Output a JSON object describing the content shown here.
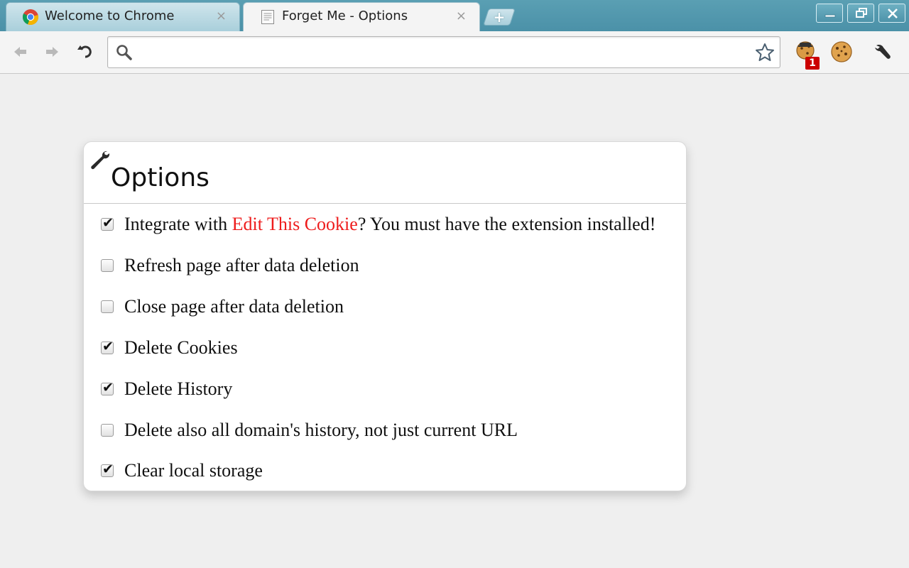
{
  "browser": {
    "tabs": [
      {
        "title": "Welcome to Chrome",
        "close": "×",
        "favicon": "chrome-logo-icon",
        "active": false
      },
      {
        "title": "Forget Me - Options",
        "close": "×",
        "favicon": "page-icon",
        "active": true
      }
    ],
    "new_tab_label": "+",
    "window_controls": [
      "minimize-icon",
      "restore-icon",
      "close-icon"
    ]
  },
  "toolbar": {
    "back": "back-arrow-icon",
    "forward": "forward-arrow-icon",
    "reload": "reload-icon",
    "omnibox": {
      "value": "",
      "placeholder": ""
    },
    "extensions": [
      {
        "name": "edit-this-cookie-agent-icon",
        "badge": "1"
      },
      {
        "name": "cookie-icon"
      }
    ],
    "menu": "wrench-menu-icon"
  },
  "options": {
    "title": "Options",
    "items": [
      {
        "checked": true,
        "before": "Integrate with ",
        "link": "Edit This Cookie",
        "after": "? You must have the extension installed!"
      },
      {
        "checked": false,
        "label": "Refresh page after data deletion"
      },
      {
        "checked": false,
        "label": "Close page after data deletion"
      },
      {
        "checked": true,
        "label": "Delete Cookies"
      },
      {
        "checked": true,
        "label": "Delete History"
      },
      {
        "checked": false,
        "label": "Delete also all domain's history, not just current URL"
      },
      {
        "checked": true,
        "label": "Clear local storage"
      }
    ]
  },
  "colors": {
    "tabstrip": "#4b91a8",
    "link": "#ee1c1c",
    "badge": "#cc0000",
    "page_bg": "#efefef"
  }
}
